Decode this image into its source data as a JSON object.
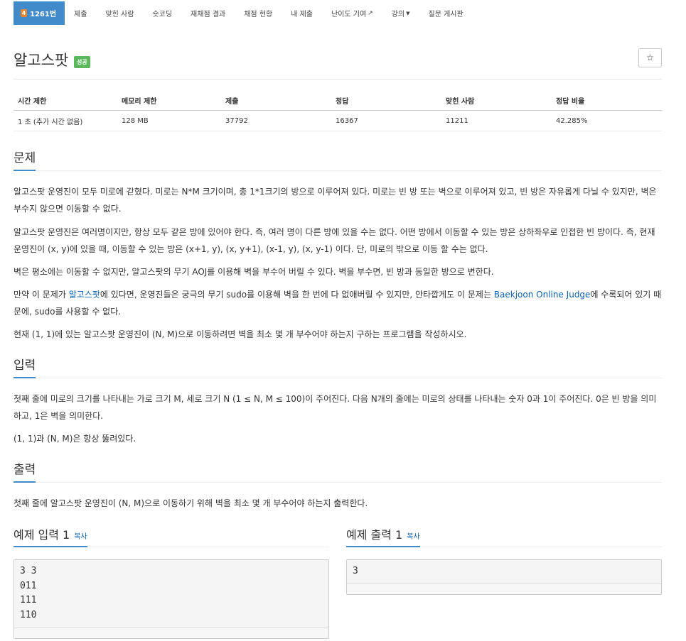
{
  "nav": {
    "items": [
      {
        "label": "1261번",
        "active": true,
        "tier": "4"
      },
      {
        "label": "제출"
      },
      {
        "label": "맞힌 사람"
      },
      {
        "label": "숏코딩"
      },
      {
        "label": "재채점 결과"
      },
      {
        "label": "채점 현황"
      },
      {
        "label": "내 제출"
      },
      {
        "label": "난이도 기여"
      },
      {
        "label": "강의"
      },
      {
        "label": "질문 게시판"
      }
    ]
  },
  "problem": {
    "title": "알고스팟",
    "badge": "성공",
    "star": "☆"
  },
  "stats": {
    "headers": [
      "시간 제한",
      "메모리 제한",
      "제출",
      "정답",
      "맞힌 사람",
      "정답 비율"
    ],
    "values": [
      "1 초 (추가 시간 없음)",
      "128 MB",
      "37792",
      "16367",
      "11211",
      "42.285%"
    ]
  },
  "sections": {
    "description_title": "문제",
    "desc1": "알고스팟 운영진이 모두 미로에 갇혔다. 미로는 N*M 크기이며, 총 1*1크기의 방으로 이루어져 있다. 미로는 빈 방 또는 벽으로 이루어져 있고, 빈 방은 자유롭게 다닐 수 있지만, 벽은 부수지 않으면 이동할 수 없다.",
    "desc2": "알고스팟 운영진은 여러명이지만, 항상 모두 같은 방에 있어야 한다. 즉, 여러 명이 다른 방에 있을 수는 없다. 어떤 방에서 이동할 수 있는 방은 상하좌우로 인접한 빈 방이다. 즉, 현재 운영진이 (x, y)에 있을 때, 이동할 수 있는 방은 (x+1, y), (x, y+1), (x-1, y), (x, y-1) 이다. 단, 미로의 밖으로 이동 할 수는 없다.",
    "desc3": "벽은 평소에는 이동할 수 없지만, 알고스팟의 무기 AOJ를 이용해 벽을 부수어 버릴 수 있다. 벽을 부수면, 빈 방과 동일한 방으로 변한다.",
    "desc4_a": "만약 이 문제가 ",
    "desc4_link1": "알고스팟",
    "desc4_b": "에 있다면, 운영진들은 궁극의 무기 sudo를 이용해 벽을 한 번에 다 없애버릴 수 있지만, 안타깝게도 이 문제는 ",
    "desc4_link2": "Baekjoon Online Judge",
    "desc4_c": "에 수록되어 있기 때문에, sudo를 사용할 수 없다.",
    "desc5": "현재 (1, 1)에 있는 알고스팟 운영진이 (N, M)으로 이동하려면 벽을 최소 몇 개 부수어야 하는지 구하는 프로그램을 작성하시오.",
    "input_title": "입력",
    "input1": "첫째 줄에 미로의 크기를 나타내는 가로 크기 M, 세로 크기 N (1 ≤ N, M ≤ 100)이 주어진다. 다음 N개의 줄에는 미로의 상태를 나타내는 숫자 0과 1이 주어진다. 0은 빈 방을 의미하고, 1은 벽을 의미한다.",
    "input2": "(1, 1)과 (N, M)은 항상 뚫려있다.",
    "output_title": "출력",
    "output1": "첫째 줄에 알고스팟 운영진이 (N, M)으로 이동하기 위해 벽을 최소 몇 개 부수어야 하는지 출력한다."
  },
  "examples": {
    "input_title": "예제 입력 1",
    "output_title": "예제 출력 1",
    "copy_label": "복사",
    "input_text": "3 3\n011\n111\n110",
    "output_text": "3"
  }
}
